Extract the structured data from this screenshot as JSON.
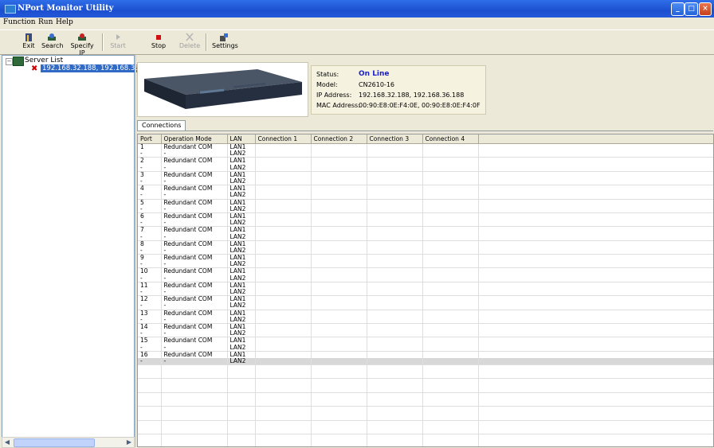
{
  "window": {
    "title": "NPort Monitor Utility",
    "buttons": [
      "_",
      "□",
      "×"
    ]
  },
  "menu": [
    "Function",
    "Run",
    "Help"
  ],
  "toolbar": [
    {
      "key": "exit",
      "label": "Exit",
      "enabled": true,
      "icon": "exit-icon"
    },
    {
      "key": "search",
      "label": "Search",
      "enabled": true,
      "icon": "search-icon"
    },
    {
      "key": "specify",
      "label": "Specify IP",
      "enabled": true,
      "icon": "specify-ip-icon"
    },
    {
      "key": "start",
      "label": "Start",
      "enabled": false,
      "icon": "start-icon"
    },
    {
      "key": "stop",
      "label": "Stop",
      "enabled": true,
      "icon": "stop-icon"
    },
    {
      "key": "delete",
      "label": "Delete",
      "enabled": false,
      "icon": "delete-icon"
    },
    {
      "key": "settings",
      "label": "Settings",
      "enabled": true,
      "icon": "settings-icon"
    }
  ],
  "tree": {
    "root": "Server List",
    "node": "192.168.32.188, 192.168.36.188"
  },
  "device": {
    "status_label": "Status:",
    "status": "On Line",
    "model_label": "Model:",
    "model": "CN2610-16",
    "ip_label": "IP Address:",
    "ip": "192.168.32.188, 192.168.36.188",
    "mac_label": "MAC Address:",
    "mac": "00:90:E8:0E:F4:0E, 00:90:E8:0E:F4:0F"
  },
  "tab": "Connections",
  "table": {
    "columns": [
      "Port",
      "Operation Mode",
      "LAN",
      "Connection 1",
      "Connection 2",
      "Connection 3",
      "Connection 4"
    ],
    "rows": [
      [
        "1",
        "Redundant COM",
        "LAN1"
      ],
      [
        "-",
        "-",
        "LAN2"
      ],
      [
        "2",
        "Redundant COM",
        "LAN1"
      ],
      [
        "-",
        "-",
        "LAN2"
      ],
      [
        "3",
        "Redundant COM",
        "LAN1"
      ],
      [
        "-",
        "-",
        "LAN2"
      ],
      [
        "4",
        "Redundant COM",
        "LAN1"
      ],
      [
        "-",
        "-",
        "LAN2"
      ],
      [
        "5",
        "Redundant COM",
        "LAN1"
      ],
      [
        "-",
        "-",
        "LAN2"
      ],
      [
        "6",
        "Redundant COM",
        "LAN1"
      ],
      [
        "-",
        "-",
        "LAN2"
      ],
      [
        "7",
        "Redundant COM",
        "LAN1"
      ],
      [
        "-",
        "-",
        "LAN2"
      ],
      [
        "8",
        "Redundant COM",
        "LAN1"
      ],
      [
        "-",
        "-",
        "LAN2"
      ],
      [
        "9",
        "Redundant COM",
        "LAN1"
      ],
      [
        "-",
        "-",
        "LAN2"
      ],
      [
        "10",
        "Redundant COM",
        "LAN1"
      ],
      [
        "-",
        "-",
        "LAN2"
      ],
      [
        "11",
        "Redundant COM",
        "LAN1"
      ],
      [
        "-",
        "-",
        "LAN2"
      ],
      [
        "12",
        "Redundant COM",
        "LAN1"
      ],
      [
        "-",
        "-",
        "LAN2"
      ],
      [
        "13",
        "Redundant COM",
        "LAN1"
      ],
      [
        "-",
        "-",
        "LAN2"
      ],
      [
        "14",
        "Redundant COM",
        "LAN1"
      ],
      [
        "-",
        "-",
        "LAN2"
      ],
      [
        "15",
        "Redundant COM",
        "LAN1"
      ],
      [
        "-",
        "-",
        "LAN2"
      ],
      [
        "16",
        "Redundant COM",
        "LAN1"
      ],
      [
        "-",
        "-",
        "LAN2"
      ]
    ]
  }
}
